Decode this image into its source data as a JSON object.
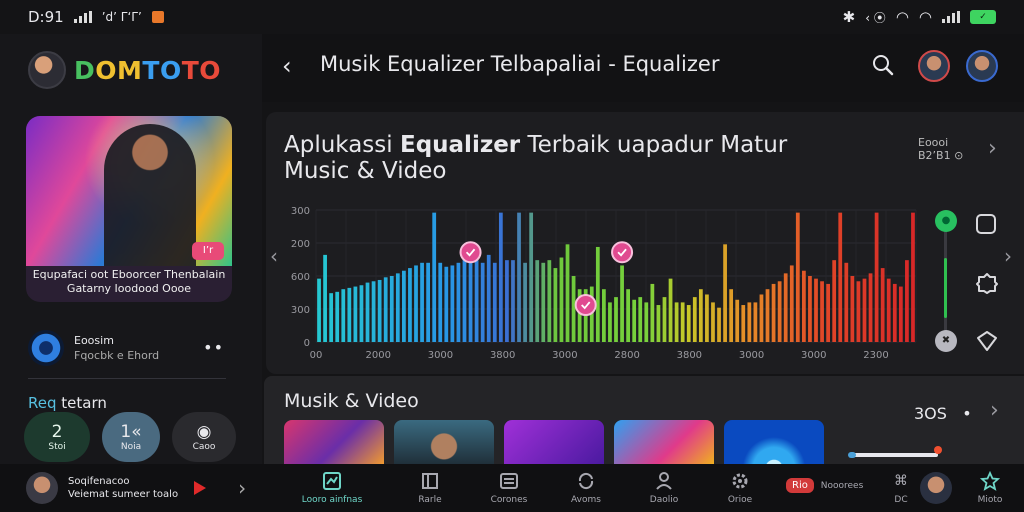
{
  "status_bar": {
    "time": "D:91",
    "left_text": "’d’ Γ‘Γ’",
    "right_text": "‹ ⦿",
    "battery": "✓"
  },
  "sidebar": {
    "brand": {
      "d": "D",
      "om": "OM",
      "to": "TO",
      "t2": "TO"
    },
    "hero_badge": "I’r",
    "hero_caption_1": "Equpafaci oot Eboorcer Thenbalain",
    "hero_caption_2": "Gatarny Ioodood Oooe",
    "track": {
      "title": "Eoosim",
      "sub": "Fqocbk e Ehord"
    },
    "requests_label_1": "Req",
    "requests_label_2": "tetarn",
    "pills": [
      {
        "value": "2",
        "label": "Stoi"
      },
      {
        "value": "1«",
        "label": "Noia"
      },
      {
        "value": "◉",
        "label": "Caoo"
      }
    ]
  },
  "topbar": {
    "title": "Musik Equalizer Telbapaliai  - Equalizer"
  },
  "panel": {
    "title_pre": "Aplukassi ",
    "title_bold": "Equalizer",
    "title_post": " Terbaik uapadur Matur",
    "title_line2": "Music & Video",
    "side_stat_1": "Eoooi",
    "side_stat_2": "B2’B1 ⊙"
  },
  "chart_data": {
    "type": "bar",
    "yticks": [
      "300",
      "200",
      "600",
      "300",
      "0"
    ],
    "xticks": [
      "00",
      "2000",
      "3000",
      "3800",
      "3000",
      "2800",
      "3800",
      "3000",
      "3000",
      "2300"
    ],
    "values": [
      48,
      66,
      37,
      38,
      40,
      41,
      42,
      43,
      45,
      46,
      47,
      49,
      50,
      52,
      54,
      56,
      58,
      60,
      60,
      98,
      60,
      57,
      58,
      60,
      62,
      64,
      62,
      60,
      66,
      60,
      98,
      62,
      62,
      98,
      60,
      98,
      62,
      60,
      62,
      56,
      64,
      74,
      50,
      40,
      40,
      42,
      72,
      40,
      30,
      34,
      58,
      40,
      32,
      34,
      30,
      44,
      28,
      34,
      48,
      30,
      30,
      28,
      34,
      40,
      36,
      30,
      26,
      74,
      40,
      32,
      28,
      30,
      30,
      36,
      40,
      44,
      46,
      52,
      58,
      98,
      54,
      50,
      48,
      46,
      44,
      62,
      98,
      60,
      50,
      46,
      48,
      52,
      98,
      56,
      48,
      44,
      42,
      62,
      98
    ],
    "markers": [
      {
        "index": 25,
        "value": 68
      },
      {
        "index": 44,
        "value": 28
      },
      {
        "index": 50,
        "value": 68
      }
    ]
  },
  "controls": {
    "upper_knob": "●",
    "lower_knob": "✖"
  },
  "section2": {
    "title": "Musik & Video",
    "count": "3OS",
    "dot": "•"
  },
  "navbar": {
    "now_playing_1": "Soqifenacoo",
    "now_playing_2": "Veiemat sumeer toalo",
    "items": [
      {
        "label": "Looro ainfnas",
        "active": true
      },
      {
        "label": "Rarle",
        "active": false
      },
      {
        "label": "Corones",
        "active": false
      },
      {
        "label": "Avoms",
        "active": false
      },
      {
        "label": "Daolio",
        "active": false
      },
      {
        "label": "Orioe",
        "active": false
      },
      {
        "label": "Nooorees",
        "active": false
      },
      {
        "label": "DC",
        "active": false
      },
      {
        "label": "Mioto",
        "active": false
      }
    ],
    "badge": "Rio"
  }
}
